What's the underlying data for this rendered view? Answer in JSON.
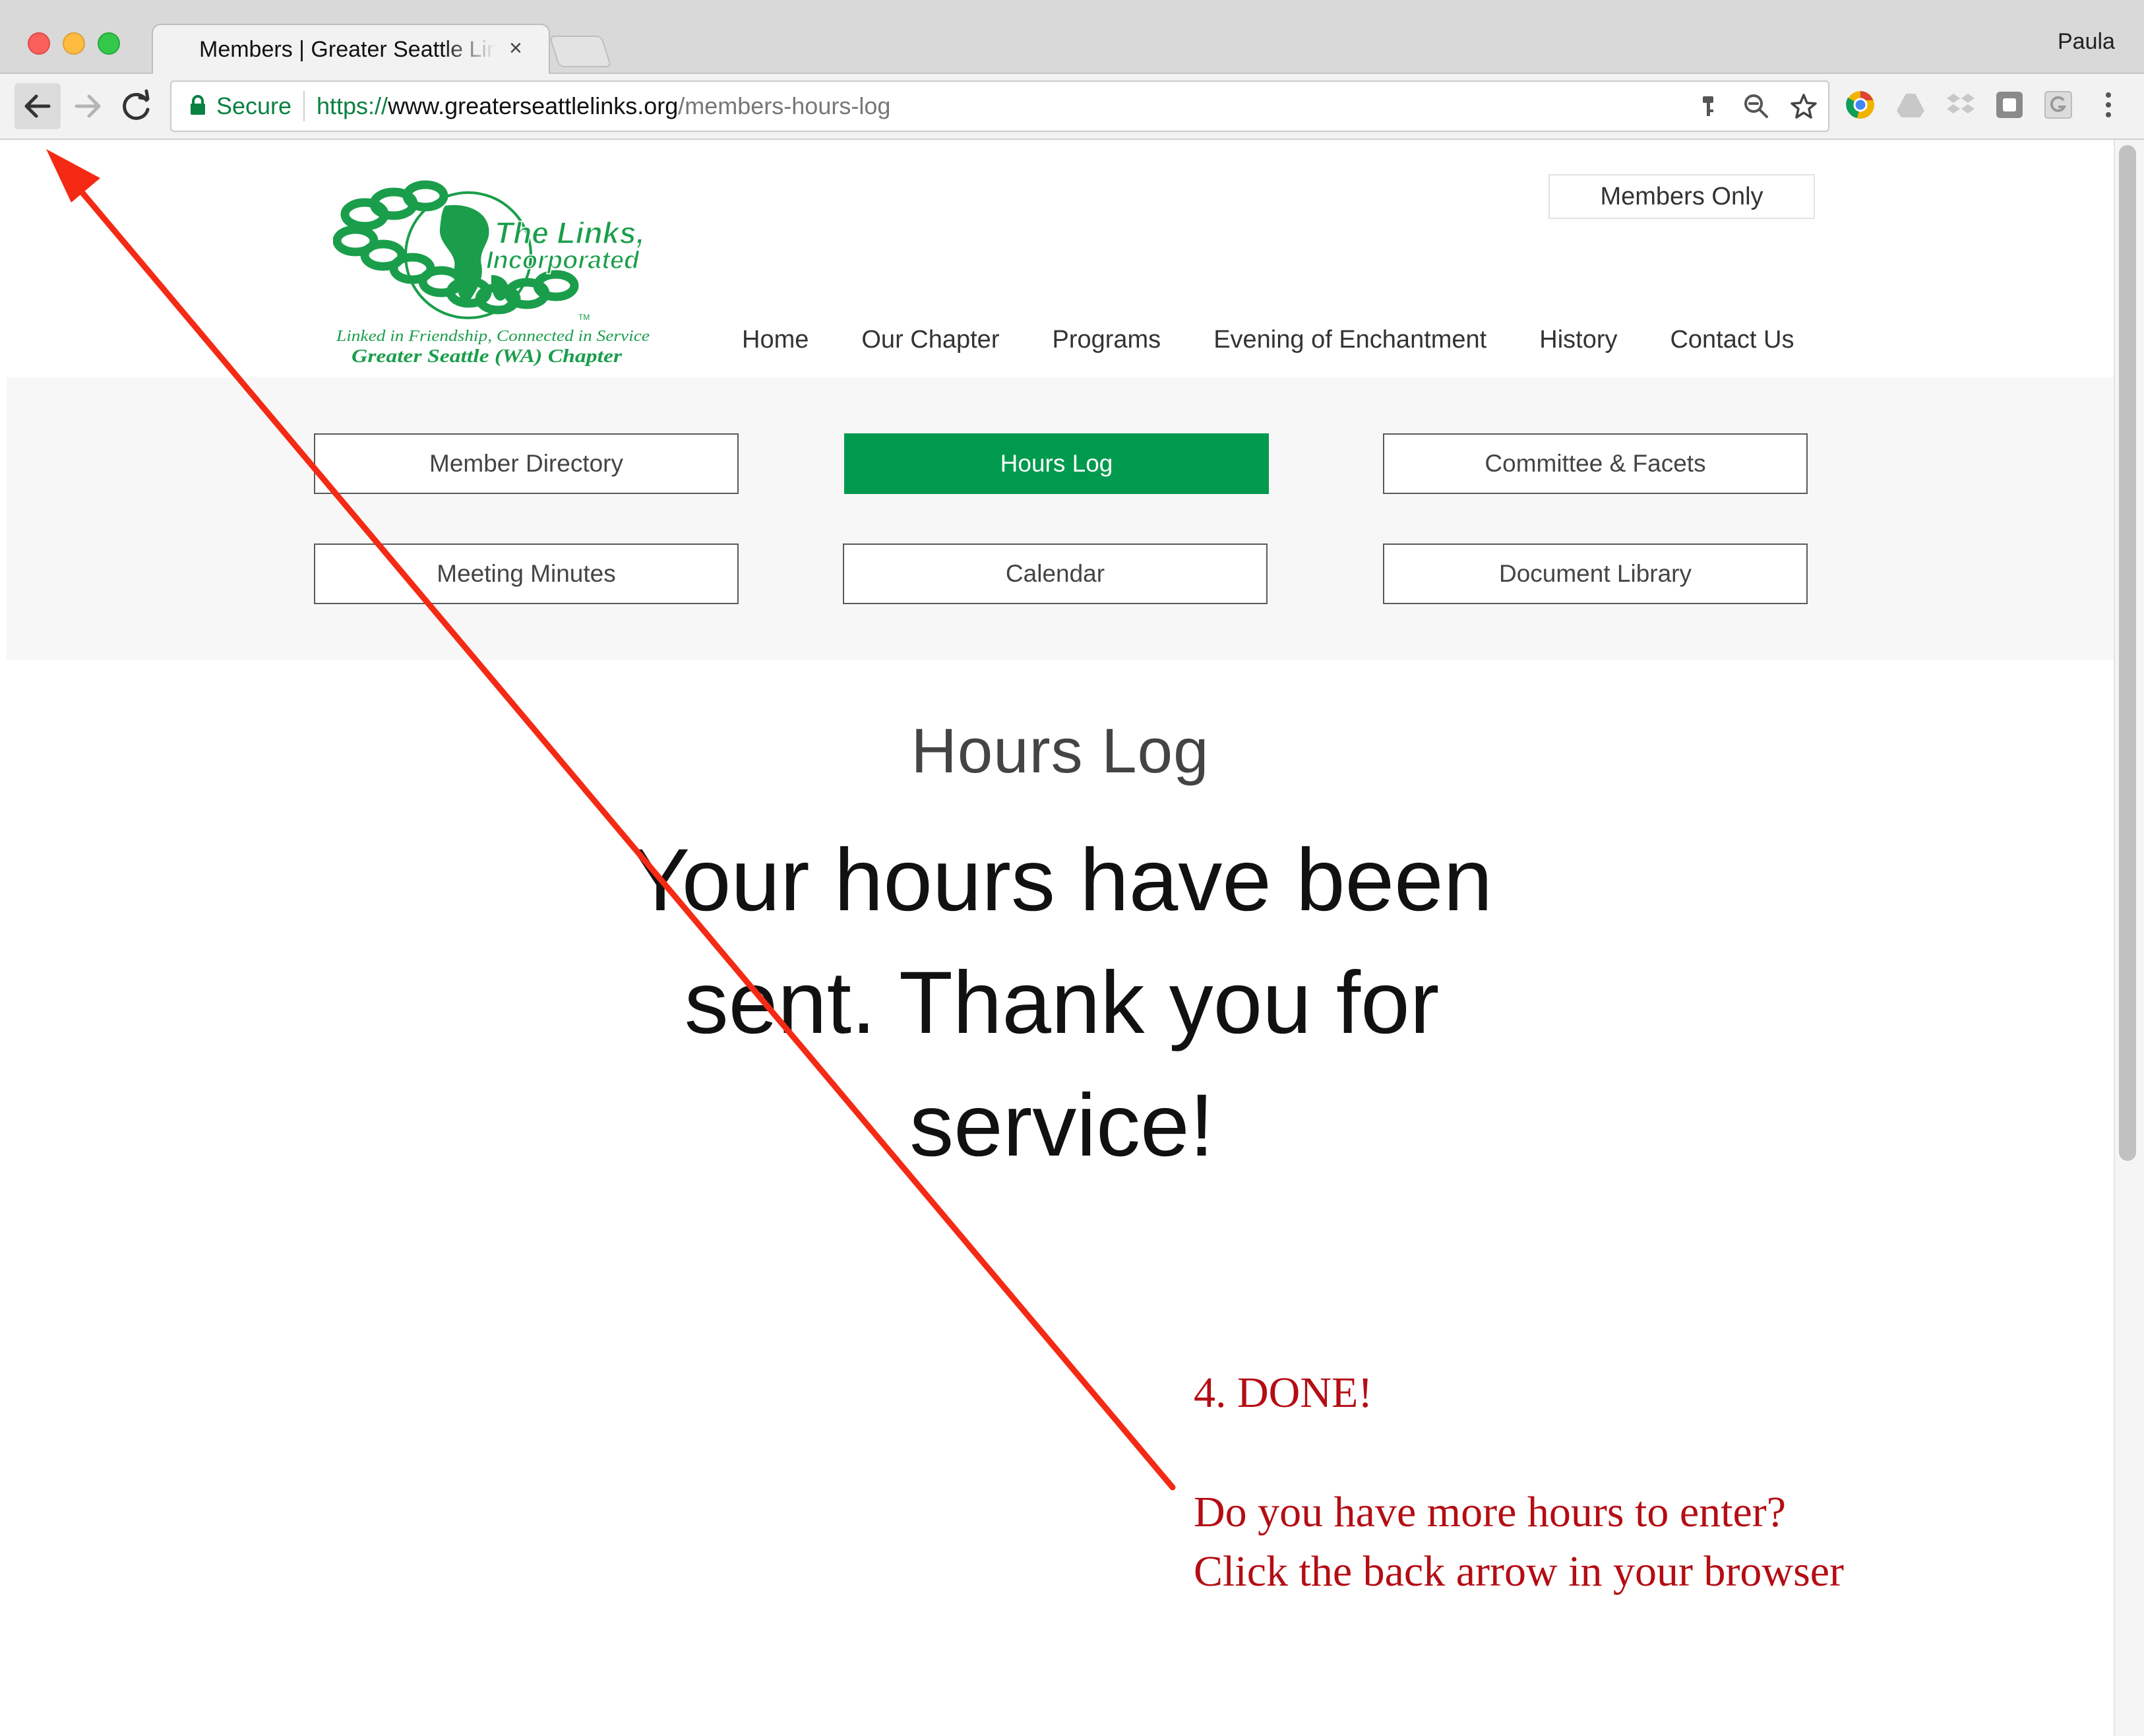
{
  "browser": {
    "tab_title": "Members | Greater Seattle Links, Incorporated",
    "tab_close": "×",
    "profile_name": "Paula",
    "secure_label": "Secure",
    "url_scheme": "https://",
    "url_host": "www.greaterseattlelinks.org",
    "url_path": "/members-hours-log"
  },
  "site": {
    "logo": {
      "name_line1": "The Links,",
      "name_line2": "Incorporated",
      "trademark": "TM",
      "tagline": "Linked in Friendship, Connected in Service",
      "chapter": "Greater Seattle (WA) Chapter"
    },
    "members_only": "Members Only",
    "nav": [
      "Home",
      "Our Chapter",
      "Programs",
      "Evening of Enchantment",
      "History",
      "Contact Us"
    ],
    "member_menu": {
      "member_directory": "Member Directory",
      "hours_log": "Hours Log",
      "committee": "Committee & Facets",
      "meeting_minutes": "Meeting Minutes",
      "calendar": "Calendar",
      "document_library": "Document Library"
    },
    "page_heading": "Hours Log",
    "confirmation": "Your hours have been sent. Thank you for service!"
  },
  "annotation": {
    "step": "4. DONE!",
    "line1": "Do you have more hours to enter?",
    "line2": "Click the back arrow in your browser"
  },
  "colors": {
    "brand_green": "#009a4e",
    "annotation_red": "#b40d14",
    "arrow_red": "#f42a14",
    "secure_green": "#0b8043"
  }
}
